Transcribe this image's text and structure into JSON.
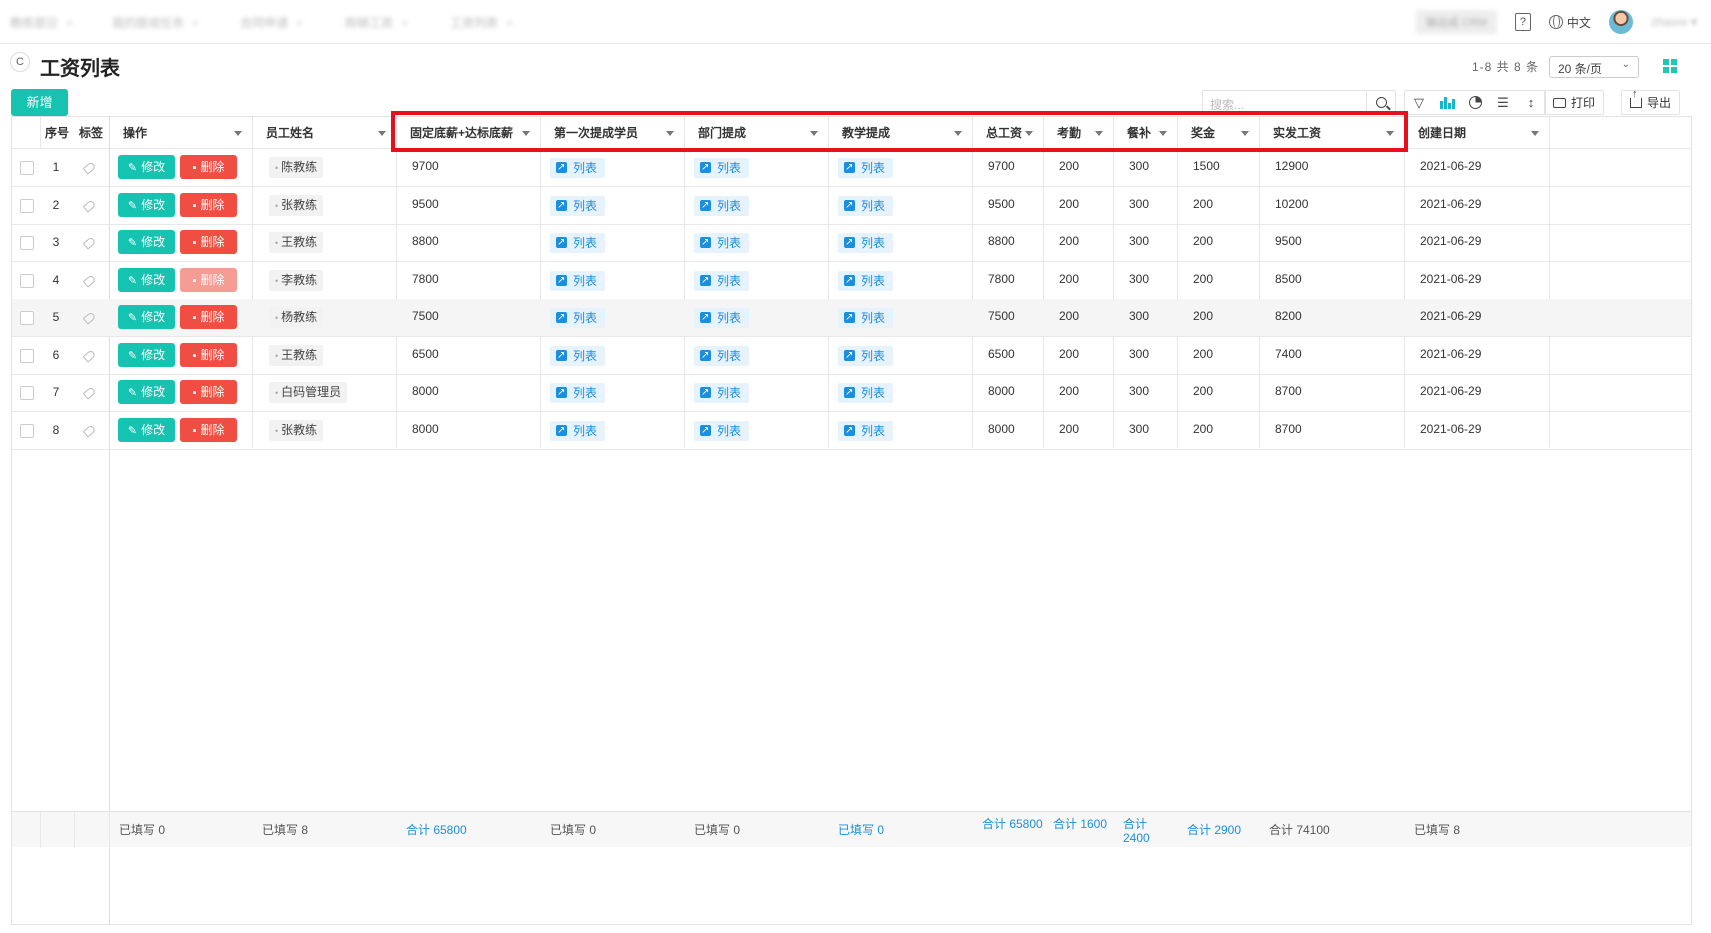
{
  "topbar": {
    "tabs": [
      "教练提日",
      "我的提成任务",
      "合同申请",
      "购销工资",
      "工资列表"
    ],
    "blurred_box": "输出成 CRM",
    "help": "?",
    "lang": "中文",
    "user": "zhaore"
  },
  "page": {
    "title": "工资列表",
    "refresh": "C",
    "pager_info": "1-8 共 8 条",
    "page_size": "20 条/页",
    "add_label": "新增"
  },
  "toolbar": {
    "search_placeholder": "搜索...",
    "print_label": "打印",
    "export_label": "导出",
    "sort_icon": "↕"
  },
  "columns": {
    "seq": "序号",
    "tag": "标签",
    "ops": "操作",
    "name": "员工姓名",
    "base": "固定底薪+达标底薪",
    "first": "第一次提成学员",
    "dept": "部门提成",
    "teach": "教学提成",
    "total": "总工资",
    "attend": "考勤",
    "meal": "餐补",
    "bonus": "奖金",
    "actual": "实发工资",
    "created": "创建日期"
  },
  "labels": {
    "edit": "修改",
    "delete": "删除",
    "list": "列表",
    "edit_icon": "✎",
    "delete_icon": "▪"
  },
  "rows": [
    {
      "seq": "1",
      "name": "陈教练",
      "base": "9700",
      "total": "9700",
      "attend": "200",
      "meal": "300",
      "bonus": "1500",
      "actual": "12900",
      "created": "2021-06-29",
      "delete_disabled": false
    },
    {
      "seq": "2",
      "name": "张教练",
      "base": "9500",
      "total": "9500",
      "attend": "200",
      "meal": "300",
      "bonus": "200",
      "actual": "10200",
      "created": "2021-06-29",
      "delete_disabled": false
    },
    {
      "seq": "3",
      "name": "王教练",
      "base": "8800",
      "total": "8800",
      "attend": "200",
      "meal": "300",
      "bonus": "200",
      "actual": "9500",
      "created": "2021-06-29",
      "delete_disabled": false
    },
    {
      "seq": "4",
      "name": "李教练",
      "base": "7800",
      "total": "7800",
      "attend": "200",
      "meal": "300",
      "bonus": "200",
      "actual": "8500",
      "created": "2021-06-29",
      "delete_disabled": true
    },
    {
      "seq": "5",
      "name": "杨教练",
      "base": "7500",
      "total": "7500",
      "attend": "200",
      "meal": "300",
      "bonus": "200",
      "actual": "8200",
      "created": "2021-06-29",
      "delete_disabled": false
    },
    {
      "seq": "6",
      "name": "王教练",
      "base": "6500",
      "total": "6500",
      "attend": "200",
      "meal": "300",
      "bonus": "200",
      "actual": "7400",
      "created": "2021-06-29",
      "delete_disabled": false
    },
    {
      "seq": "7",
      "name": "白码管理员",
      "base": "8000",
      "total": "8000",
      "attend": "200",
      "meal": "300",
      "bonus": "200",
      "actual": "8700",
      "created": "2021-06-29",
      "delete_disabled": false
    },
    {
      "seq": "8",
      "name": "张教练",
      "base": "8000",
      "total": "8000",
      "attend": "200",
      "meal": "300",
      "bonus": "200",
      "actual": "8700",
      "created": "2021-06-29",
      "delete_disabled": false
    }
  ],
  "footer": {
    "ops": "已填写 0",
    "name": "已填写 8",
    "base": "合计 65800",
    "first": "已填写 0",
    "dept": "已填写 0",
    "teach": "已填写 0",
    "total": "合计 65800",
    "attend": "合计 1600",
    "meal": "合计 2400",
    "bonus": "合计 2900",
    "actual": "合计 74100",
    "created": "已填写 8"
  },
  "colors": {
    "accent": "#16c3b0",
    "danger": "#f04e42",
    "link": "#1a8fe0",
    "highlight": "#e8111b"
  }
}
